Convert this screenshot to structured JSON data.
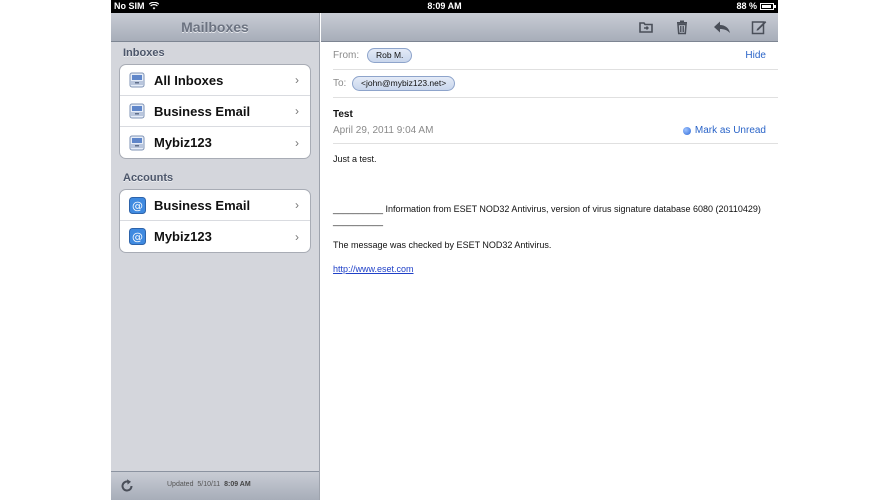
{
  "status_bar": {
    "carrier": "No SIM",
    "time": "8:09 AM",
    "battery": "88 %",
    "battery_level": 0.88
  },
  "left_pane": {
    "title": "Mailboxes",
    "sections": [
      {
        "label": "Inboxes",
        "items": [
          {
            "label": "All Inboxes",
            "icon": "inbox-tray-icon"
          },
          {
            "label": "Business Email",
            "icon": "inbox-tray-icon"
          },
          {
            "label": "Mybiz123",
            "icon": "inbox-tray-icon"
          }
        ]
      },
      {
        "label": "Accounts",
        "items": [
          {
            "label": "Business Email",
            "icon": "at-sign-icon"
          },
          {
            "label": "Mybiz123",
            "icon": "at-sign-icon"
          }
        ]
      }
    ],
    "updated_label": "Updated",
    "updated_date": "5/10/11",
    "updated_time": "8:09 AM"
  },
  "toolbar": {
    "icons": [
      "folder-move-icon",
      "trash-icon",
      "reply-icon",
      "compose-icon"
    ]
  },
  "message": {
    "from_label": "From:",
    "from": "Rob M.",
    "hide_label": "Hide",
    "to_label": "To:",
    "to": "<john@mybiz123.net>",
    "subject": "Test",
    "date": "April 29, 2011 9:04 AM",
    "mark_unread_label": "Mark as Unread",
    "body_line1": "Just a test.",
    "body_eset": "__________ Information from ESET NOD32 Antivirus, version of virus signature database 6080 (20110429) __________",
    "body_checked": "The message was checked by ESET NOD32 Antivirus.",
    "body_link": "http://www.eset.com"
  },
  "colors": {
    "link_blue": "#2a64c8",
    "sidebar_bg": "#d4d6dc"
  }
}
